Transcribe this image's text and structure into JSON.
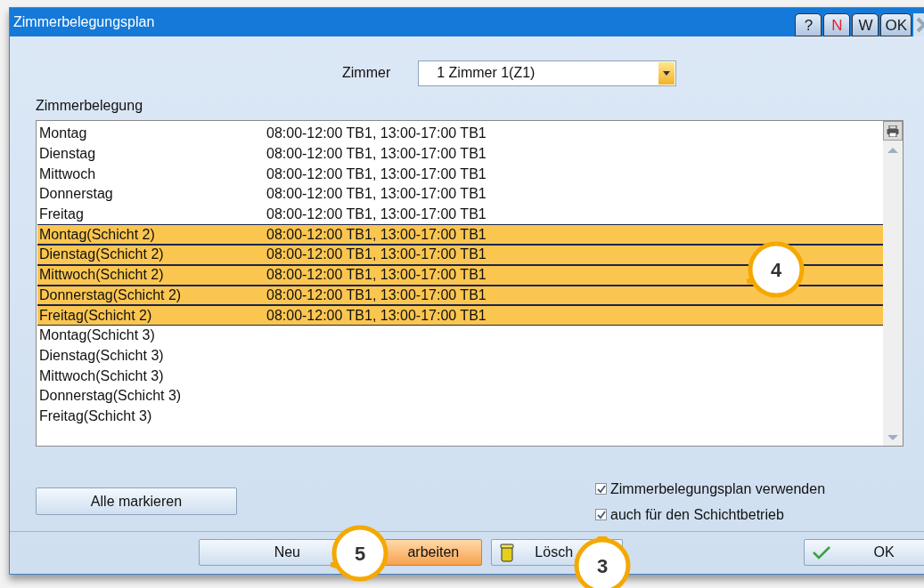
{
  "window": {
    "title": "Zimmerbelegungsplan"
  },
  "title_buttons": [
    {
      "label": "?",
      "color": "#1a1a1a"
    },
    {
      "label": "N",
      "color": "#e8202a"
    },
    {
      "label": "W",
      "color": "#1a1a1a"
    },
    {
      "label": "OK",
      "color": "#1a1a1a"
    }
  ],
  "room": {
    "label": "Zimmer",
    "value": "1 Zimmer 1(Z1)"
  },
  "schedule": {
    "label": "Zimmerbelegung",
    "rows": [
      {
        "day": "Montag",
        "times": "08:00-12:00 TB1, 13:00-17:00 TB1",
        "selected": false
      },
      {
        "day": "Dienstag",
        "times": "08:00-12:00 TB1, 13:00-17:00 TB1",
        "selected": false
      },
      {
        "day": "Mittwoch",
        "times": "08:00-12:00 TB1, 13:00-17:00 TB1",
        "selected": false
      },
      {
        "day": "Donnerstag",
        "times": "08:00-12:00 TB1, 13:00-17:00 TB1",
        "selected": false
      },
      {
        "day": "Freitag",
        "times": "08:00-12:00 TB1, 13:00-17:00 TB1",
        "selected": false
      },
      {
        "day": "Montag(Schicht 2)",
        "times": "08:00-12:00 TB1, 13:00-17:00 TB1",
        "selected": true
      },
      {
        "day": "Dienstag(Schicht 2)",
        "times": "08:00-12:00 TB1, 13:00-17:00 TB1",
        "selected": true
      },
      {
        "day": "Mittwoch(Schicht 2)",
        "times": "08:00-12:00 TB1, 13:00-17:00 TB1",
        "selected": true
      },
      {
        "day": "Donnerstag(Schicht 2)",
        "times": "08:00-12:00 TB1, 13:00-17:00 TB1",
        "selected": true
      },
      {
        "day": "Freitag(Schicht 2)",
        "times": "08:00-12:00 TB1, 13:00-17:00 TB1",
        "selected": true
      },
      {
        "day": "Montag(Schicht 3)",
        "selected": false
      },
      {
        "day": "Dienstag(Schicht 3)",
        "selected": false
      },
      {
        "day": "Mittwoch(Schicht 3)",
        "selected": false
      },
      {
        "day": "Donnerstag(Schicht 3)",
        "selected": false
      },
      {
        "day": "Freitag(Schicht 3)",
        "selected": false
      }
    ]
  },
  "mark_all_button": "Alle markieren",
  "checkboxes": [
    {
      "label": "Zimmerbelegungsplan verwenden",
      "checked": true
    },
    {
      "label": "auch für den Schichtbetrieb",
      "checked": true
    }
  ],
  "buttons": [
    {
      "label": "Neu",
      "kind": "default"
    },
    {
      "label": "arbeiten",
      "kind": "active"
    },
    {
      "label": "Lösch",
      "kind": "delete"
    },
    {
      "label": "OK",
      "kind": "confirm"
    }
  ],
  "callouts": [
    {
      "number": "4"
    },
    {
      "number": "5"
    },
    {
      "number": "3"
    }
  ]
}
